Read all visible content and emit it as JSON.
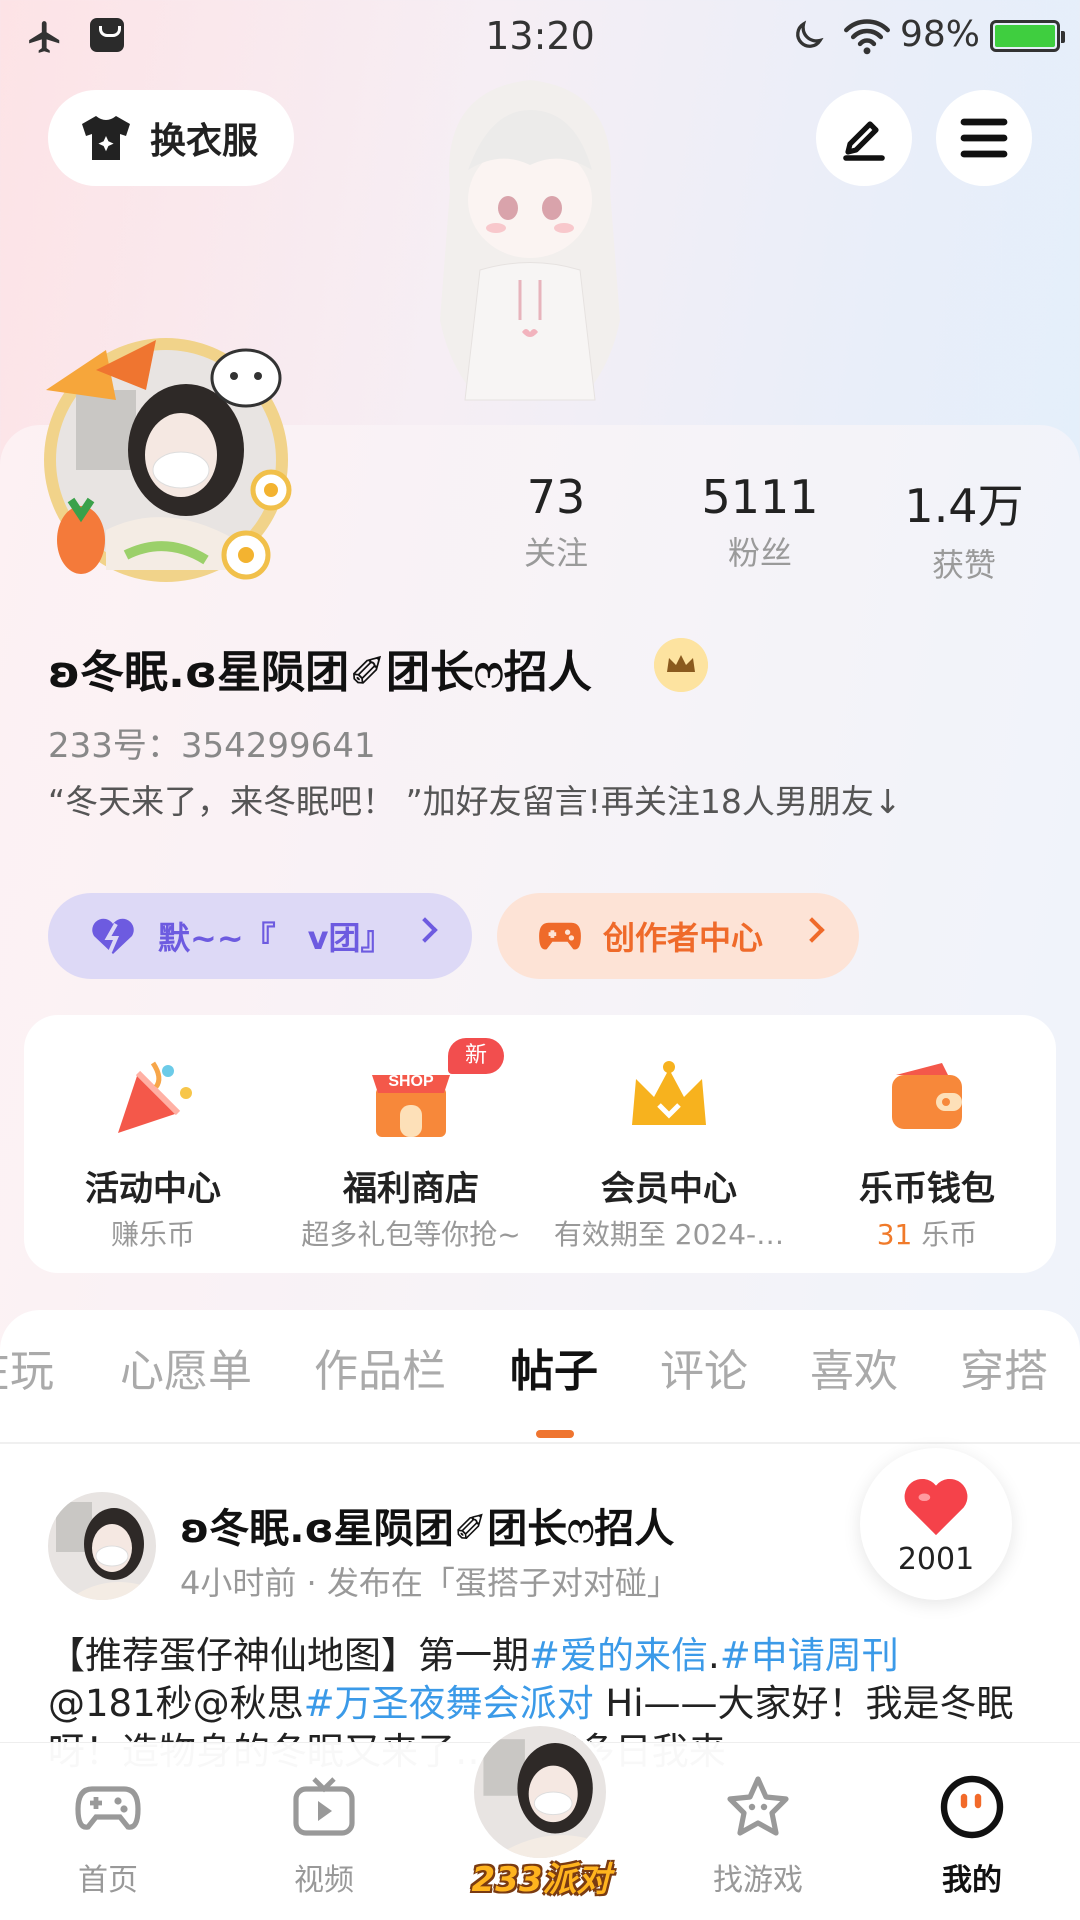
{
  "status_bar": {
    "time": "13:20",
    "battery": "98%"
  },
  "header": {
    "outfit_label": "换衣服"
  },
  "profile": {
    "stats": [
      {
        "value": "73",
        "label": "关注"
      },
      {
        "value": "5111",
        "label": "粉丝"
      },
      {
        "value": "1.4万",
        "label": "获赞"
      }
    ],
    "nickname": "ʚ冬眠.ɞ星陨团✐团长ෆ招人",
    "uid": "233号：354299641",
    "bio": "“冬天来了，来冬眠吧！ ”加好友留言!再关注18人男朋友↓",
    "group_pill": "默~~『　v团』",
    "creator_pill": "创作者中心"
  },
  "features": [
    {
      "title": "活动中心",
      "subtitle": "赚乐币"
    },
    {
      "title": "福利商店",
      "subtitle": "超多礼包等你抢~",
      "badge": "新",
      "icon_text": "SHOP"
    },
    {
      "title": "会员中心",
      "subtitle": "有效期至 2024-…"
    },
    {
      "title": "乐币钱包",
      "subtitle_value": "31",
      "subtitle_unit": " 乐币"
    }
  ],
  "tabs": [
    "在玩",
    "心愿单",
    "作品栏",
    "帖子",
    "评论",
    "喜欢",
    "穿搭"
  ],
  "active_tab": "帖子",
  "post": {
    "author": "ʚ冬眠.ɞ星陨团✐团长ෆ招人",
    "meta": "4小时前 · 发布在「蛋搭子对对碰」",
    "likes": "2001",
    "body_1": "【推荐蛋仔神仙地图】第一期",
    "tag_1": "#爱的来信",
    "body_2": ".",
    "tag_2": "#申请周刊",
    "body_3": "@181秒@秋思",
    "tag_3": "#万圣夜舞会派对",
    "body_4": " Hi——大家好！我是冬眠呀！造物身的冬眠又来了… 时隔多日我来"
  },
  "bottom_nav": [
    {
      "label": "首页"
    },
    {
      "label": "视频"
    },
    {
      "label": "233派对"
    },
    {
      "label": "找游戏"
    },
    {
      "label": "我的"
    }
  ],
  "colors": {
    "accent_orange": "#ef7530",
    "tag_blue": "#3b9ae8",
    "purple": "#6d5be0"
  }
}
